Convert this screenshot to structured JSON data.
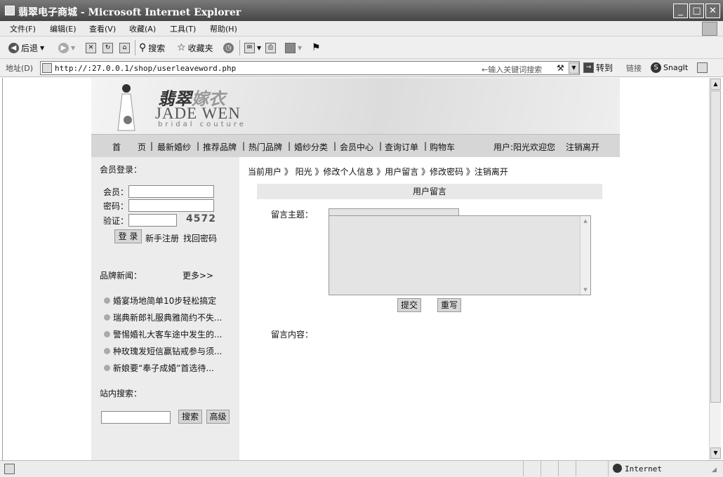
{
  "window": {
    "title": "翡翠电子商城 - Microsoft Internet Explorer"
  },
  "menu": [
    "文件(F)",
    "编辑(E)",
    "查看(V)",
    "收藏(A)",
    "工具(T)",
    "帮助(H)"
  ],
  "toolbar": {
    "back": "后退",
    "search": "搜索",
    "favorites": "收藏夹"
  },
  "address": {
    "label": "地址(D)",
    "url": "http://:27.0.0.1/shop/userleaveword.php",
    "search_hint": "←输入关键词搜索",
    "go": "转到",
    "links": "链接",
    "snagit": "SnagIt"
  },
  "status": {
    "zone": "Internet"
  },
  "site": {
    "logo_cn_1": "翡翠",
    "logo_cn_2": "嫁衣",
    "logo_en": "JADE WEN",
    "logo_sub": "bridal couture",
    "nav": [
      "首　　页",
      "最新婚纱",
      "推荐品牌",
      "热门品牌",
      "婚纱分类",
      "会员中心",
      "查询订单",
      "购物车"
    ],
    "nav_user": "用户:阳光欢迎您",
    "nav_logout": "注销离开"
  },
  "sidebar": {
    "login_title": "会员登录：",
    "member_label": "会员：",
    "password_label": "密码：",
    "captcha_label": "验证：",
    "captcha_code": "4572",
    "login_button": "登 录",
    "register": "新手注册",
    "recover": "找回密码",
    "news_title": "品牌新闻：",
    "more": "更多>>",
    "news": [
      "婚宴场地简单10步轻松搞定",
      "瑞典新郎礼服典雅简约不失...",
      "警惕婚礼大客车途中发生的...",
      "种玫瑰发短信赢钻戒参与须...",
      "新娘要“奉子成婚”首选待..."
    ],
    "search_title": "站内搜索：",
    "search_button": "搜索",
    "advanced_button": "高级"
  },
  "content": {
    "breadcrumb": "当前用户 》 阳光 》修改个人信息 》用户留言 》修改密码 》注销离开",
    "form_title": "用户留言",
    "subject_label": "留言主题：",
    "body_label": "留言内容：",
    "submit": "提交",
    "reset": "重写"
  }
}
